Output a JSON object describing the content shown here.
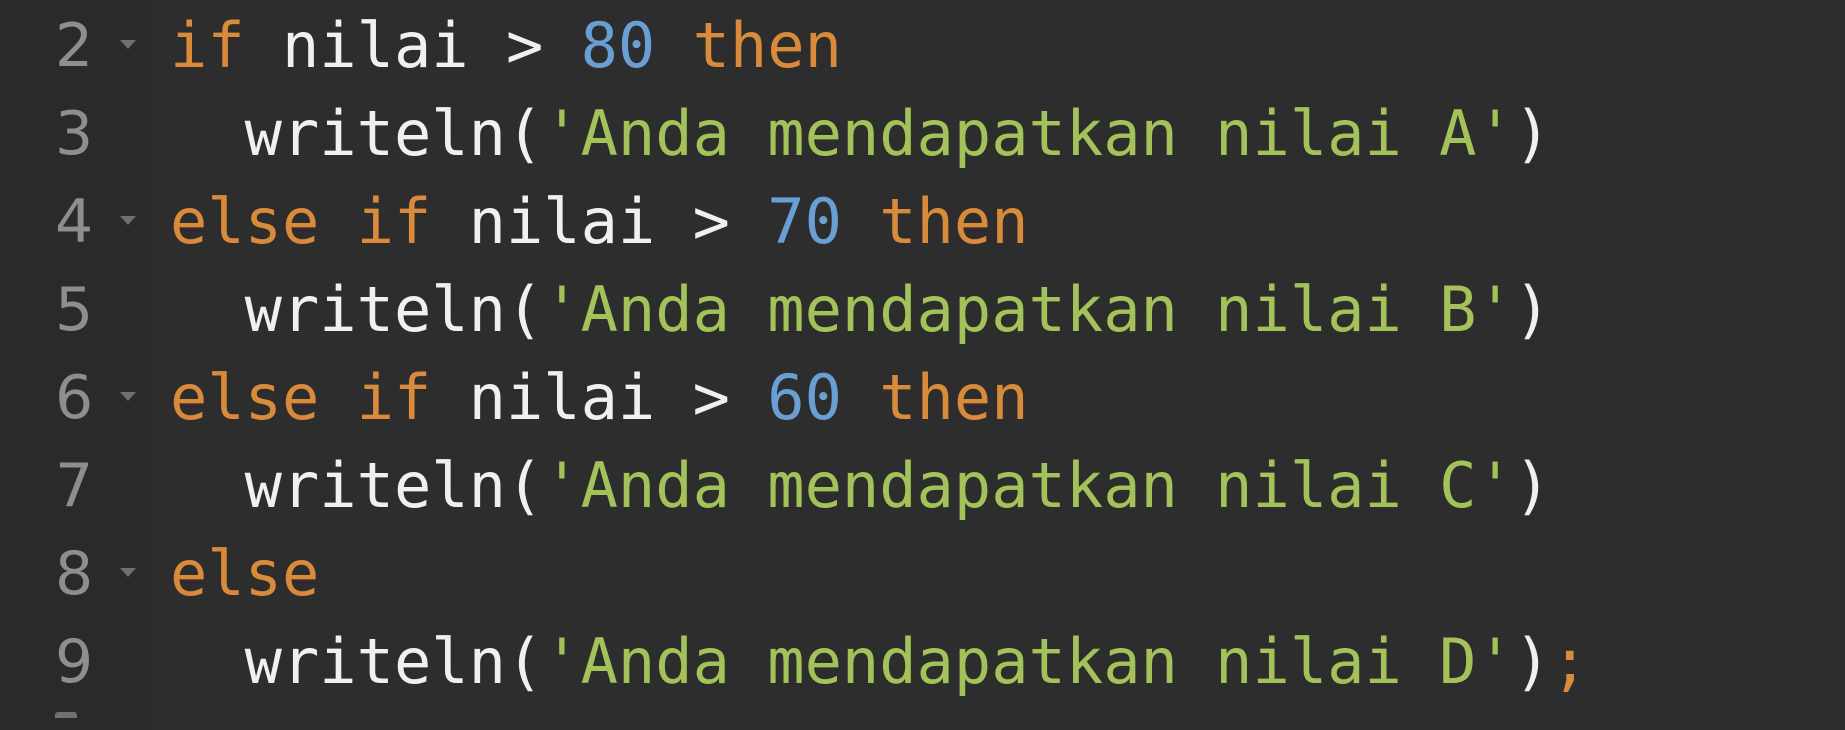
{
  "editor": {
    "colors": {
      "background": "#2d2d2d",
      "gutter": "#2a2a2a",
      "line_number": "#8e8e8e",
      "keyword": "#d98a3a",
      "identifier": "#f0f0f0",
      "number": "#6a9fd4",
      "string": "#a3c35a"
    },
    "lines": [
      {
        "number": "2",
        "foldable": true,
        "tokens": [
          {
            "type": "kw",
            "text": "if"
          },
          {
            "type": "id",
            "text": " nilai "
          },
          {
            "type": "op",
            "text": ">"
          },
          {
            "type": "id",
            "text": " "
          },
          {
            "type": "num",
            "text": "80"
          },
          {
            "type": "id",
            "text": " "
          },
          {
            "type": "kw",
            "text": "then"
          }
        ]
      },
      {
        "number": "3",
        "foldable": false,
        "tokens": [
          {
            "type": "id",
            "text": "  writeln("
          },
          {
            "type": "str",
            "text": "'Anda mendapatkan nilai A'"
          },
          {
            "type": "punc",
            "text": ")"
          }
        ]
      },
      {
        "number": "4",
        "foldable": true,
        "tokens": [
          {
            "type": "kw",
            "text": "else if"
          },
          {
            "type": "id",
            "text": " nilai "
          },
          {
            "type": "op",
            "text": ">"
          },
          {
            "type": "id",
            "text": " "
          },
          {
            "type": "num",
            "text": "70"
          },
          {
            "type": "id",
            "text": " "
          },
          {
            "type": "kw",
            "text": "then"
          }
        ]
      },
      {
        "number": "5",
        "foldable": false,
        "tokens": [
          {
            "type": "id",
            "text": "  writeln("
          },
          {
            "type": "str",
            "text": "'Anda mendapatkan nilai B'"
          },
          {
            "type": "punc",
            "text": ")"
          }
        ]
      },
      {
        "number": "6",
        "foldable": true,
        "tokens": [
          {
            "type": "kw",
            "text": "else if"
          },
          {
            "type": "id",
            "text": " nilai "
          },
          {
            "type": "op",
            "text": ">"
          },
          {
            "type": "id",
            "text": " "
          },
          {
            "type": "num",
            "text": "60"
          },
          {
            "type": "id",
            "text": " "
          },
          {
            "type": "kw",
            "text": "then"
          }
        ]
      },
      {
        "number": "7",
        "foldable": false,
        "tokens": [
          {
            "type": "id",
            "text": "  writeln("
          },
          {
            "type": "str",
            "text": "'Anda mendapatkan nilai C'"
          },
          {
            "type": "punc",
            "text": ")"
          }
        ]
      },
      {
        "number": "8",
        "foldable": true,
        "tokens": [
          {
            "type": "kw",
            "text": "else"
          }
        ]
      },
      {
        "number": "9",
        "foldable": false,
        "tokens": [
          {
            "type": "id",
            "text": "  writeln("
          },
          {
            "type": "str",
            "text": "'Anda mendapatkan nilai D'"
          },
          {
            "type": "punc",
            "text": ")"
          },
          {
            "type": "semi",
            "text": ";"
          }
        ]
      }
    ]
  }
}
